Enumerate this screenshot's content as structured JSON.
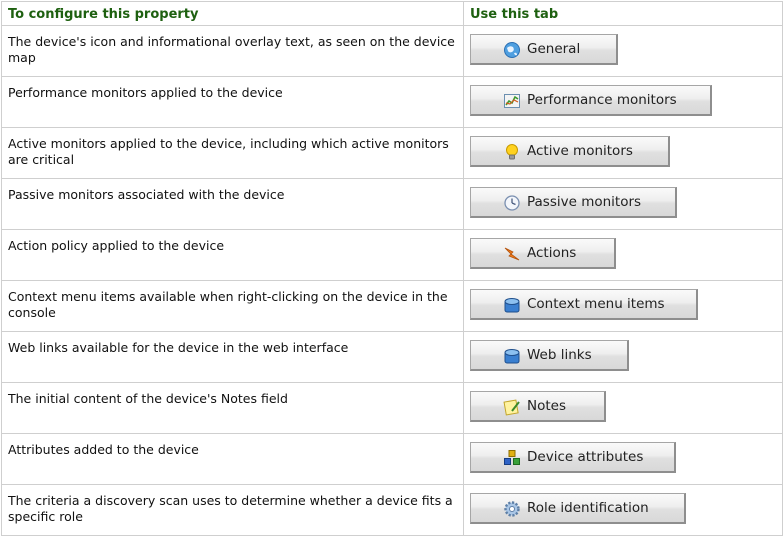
{
  "header": {
    "property": "To configure this property",
    "tab": "Use this tab"
  },
  "rows": [
    {
      "description": "The device's icon and informational overlay text, as seen on the device map",
      "tab": "General",
      "icon": "globe-icon"
    },
    {
      "description": "Performance monitors applied to the device",
      "tab": "Performance monitors",
      "icon": "chart-icon"
    },
    {
      "description": "Active monitors applied to the device, including which active monitors are critical",
      "tab": "Active monitors",
      "icon": "lightbulb-icon"
    },
    {
      "description": "Passive monitors associated with the device",
      "tab": "Passive monitors",
      "icon": "clock-icon"
    },
    {
      "description": "Action policy applied to the device",
      "tab": "Actions",
      "icon": "lightning-icon"
    },
    {
      "description": "Context menu items available when right-clicking on the device in the console",
      "tab": "Context menu items",
      "icon": "menu-icon"
    },
    {
      "description": "Web links available for the device in the web interface",
      "tab": "Web links",
      "icon": "web-icon"
    },
    {
      "description": "The initial content of the device's Notes field",
      "tab": "Notes",
      "icon": "notes-icon"
    },
    {
      "description": "Attributes added to the device",
      "tab": "Device attributes",
      "icon": "attributes-icon"
    },
    {
      "description": "The criteria a discovery scan uses to determine whether a device fits a specific role",
      "tab": "Role identification",
      "icon": "gear-icon"
    }
  ]
}
